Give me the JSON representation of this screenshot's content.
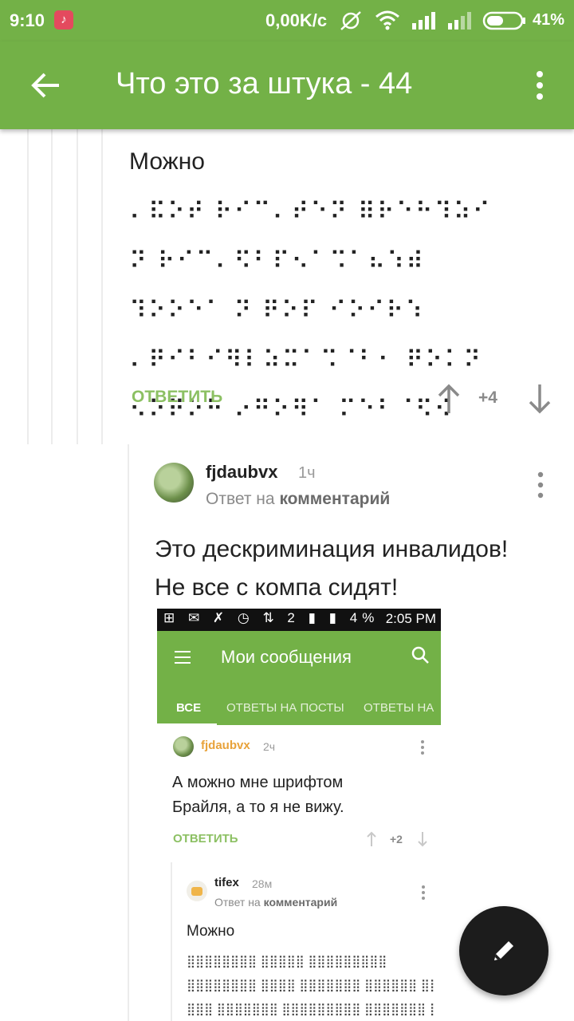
{
  "status_bar": {
    "time": "9:10",
    "speed": "0,00K/c",
    "battery": "41%"
  },
  "app_bar": {
    "title": "Что это за штука - 44",
    "color": "#73b147"
  },
  "comment_1": {
    "text": "Можно",
    "braille_lines": [
      "⠄⠯⠕⠞ ⠗⠊⠉⠄⠞⠑⠝ ⠿⠗⠑⠓⠹⠵⠊",
      "⠝ ⠗⠊⠉⠄⠫⠃⠏⠢⠁⠩⠁⠦⠱⠾",
      "⠹⠕⠕⠑⠁ ⠝ ⠟⠕⠏ ⠊⠕⠊⠗⠱",
      "⠄⠟⠊⠃⠊⠻⠇⠵⠭⠁⠩⠈⠃⠂ ⠟⠕⠅⠝",
      "⠢⠕⠟⠕⠓ ⠔⠛⠕⠻⠁ ⠍⠑⠃⠈⠫⠪"
    ],
    "reply_label": "ОТВЕТИТЬ",
    "score": "+4"
  },
  "comment_2": {
    "user": "fjdaubvx",
    "age": "1ч",
    "reply_prefix": "Ответ на",
    "reply_target": "комментарий",
    "body_line1": "Это дескриминация инвалидов!",
    "body_line2": "Не все с компа сидят!"
  },
  "screenshot": {
    "status_time": "2:05 PM",
    "status_icons": "⊞ ✉   ✗ ◷ ⇅ 2 ▮ ▮ 4%",
    "title": "Мои сообщения",
    "tabs": [
      "ВСЕ",
      "ОТВЕТЫ НА ПОСТЫ",
      "ОТВЕТЫ НА"
    ],
    "comment": {
      "user": "fjdaubvx",
      "age": "2ч",
      "line1": "А можно мне шрифтом",
      "line2": "Брайля, а то я не вижу.",
      "reply_label": "ОТВЕТИТЬ",
      "score": "+2"
    },
    "reply": {
      "user": "tifex",
      "age": "28м",
      "reply_prefix": "Ответ на",
      "reply_target": "комментарий",
      "text": "Можно",
      "braille_lines": [
        "⣿⣿⣿⣿⣿⣿⣿⣿ ⣿⣿⣿⣿⣿ ⣿⣿⣿⣿⣿⣿⣿⣿⣿",
        "⣿⣿⣿⣿⣿⣿⣿⣿ ⣿⣿⣿⣿ ⣿⣿⣿⣿⣿⣿⣿ ⣿⣿⣿⣿⣿⣿ ⣿⣿",
        "⣿⣿⣿ ⣿⣿⣿⣿⣿⣿⣿ ⣿⣿⣿⣿⣿⣿⣿⣿⣿ ⣿⣿⣿⣿⣿⣿⣿ ⣿⣿⣿"
      ]
    }
  }
}
